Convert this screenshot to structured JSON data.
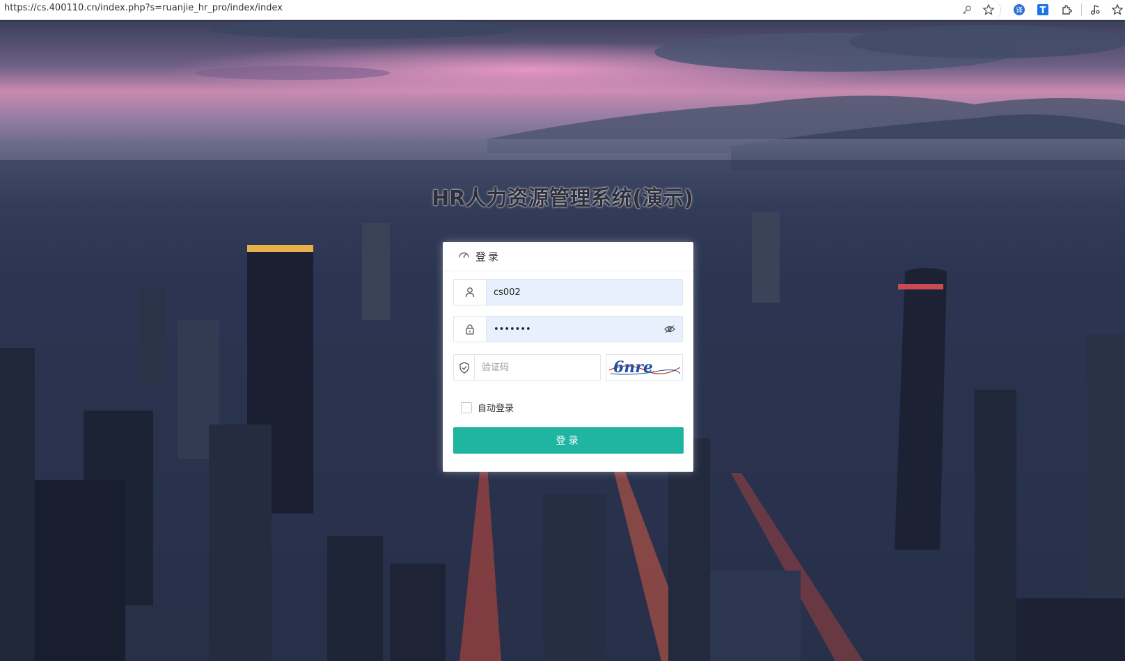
{
  "browser": {
    "url": "https://cs.400110.cn/index.php?s=ruanjie_hr_pro/index/index",
    "icons": [
      "key-icon",
      "star-icon",
      "extension-translate-icon",
      "extension-t-icon",
      "puzzle-icon",
      "media-icon",
      "favorites-icon"
    ]
  },
  "page": {
    "title": "HR人力资源管理系统(演示)"
  },
  "login": {
    "header": "登录",
    "username": "cs002",
    "password": "•••••••",
    "captcha_placeholder": "验证码",
    "captcha_text": "6nre",
    "remember_label": "自动登录",
    "submit_label": "登录"
  },
  "colors": {
    "accent": "#1fb5a0",
    "autofill": "#e8f0fe"
  }
}
